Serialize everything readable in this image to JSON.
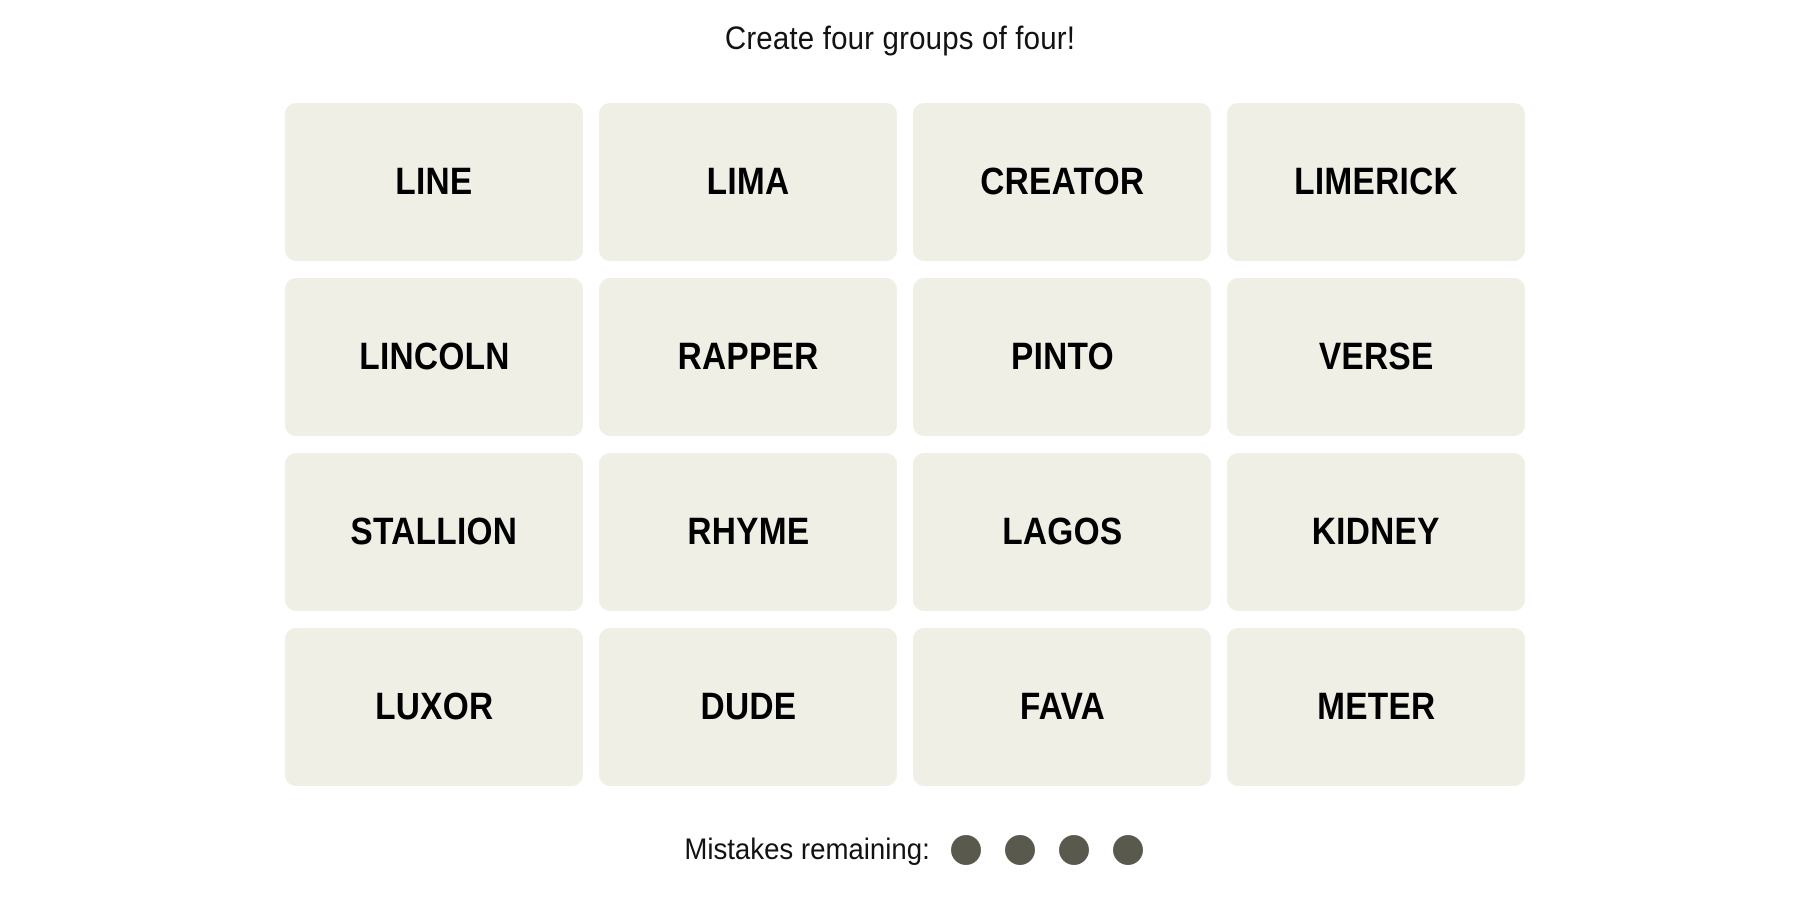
{
  "header": {
    "subtitle": "Create four groups of four!"
  },
  "board": {
    "tiles": [
      {
        "word": "LINE"
      },
      {
        "word": "LIMA"
      },
      {
        "word": "CREATOR"
      },
      {
        "word": "LIMERICK"
      },
      {
        "word": "LINCOLN"
      },
      {
        "word": "RAPPER"
      },
      {
        "word": "PINTO"
      },
      {
        "word": "VERSE"
      },
      {
        "word": "STALLION"
      },
      {
        "word": "RHYME"
      },
      {
        "word": "LAGOS"
      },
      {
        "word": "KIDNEY"
      },
      {
        "word": "LUXOR"
      },
      {
        "word": "DUDE"
      },
      {
        "word": "FAVA"
      },
      {
        "word": "METER"
      }
    ]
  },
  "mistakes": {
    "label": "Mistakes remaining:",
    "remaining": 4,
    "total": 4
  },
  "colors": {
    "tile_background": "#efefe6",
    "tile_text": "#000000",
    "mistake_dot": "#5a594e"
  }
}
